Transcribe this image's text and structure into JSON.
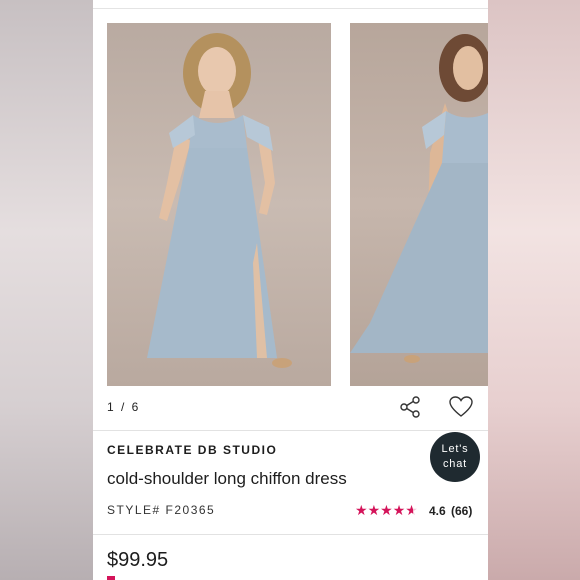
{
  "gallery": {
    "counter": "1 / 6",
    "images": [
      "model-front-dress-photo",
      "model-side-dress-photo"
    ]
  },
  "icons": {
    "share": "share-icon",
    "favorite": "heart-icon"
  },
  "product": {
    "brand": "CELEBRATE DB STUDIO",
    "title": "cold-shoulder long chiffon dress",
    "style": "STYLE# F20365",
    "rating": "4.6",
    "review_count": "(66)",
    "rating_value": 4.6,
    "price": "$99.95"
  },
  "chat": {
    "line1": "Let's",
    "line2": "chat"
  },
  "colors": {
    "accent_pink": "#d4145a",
    "chat_bg": "#1f2a30",
    "dress_blue": "#a9bccd"
  }
}
